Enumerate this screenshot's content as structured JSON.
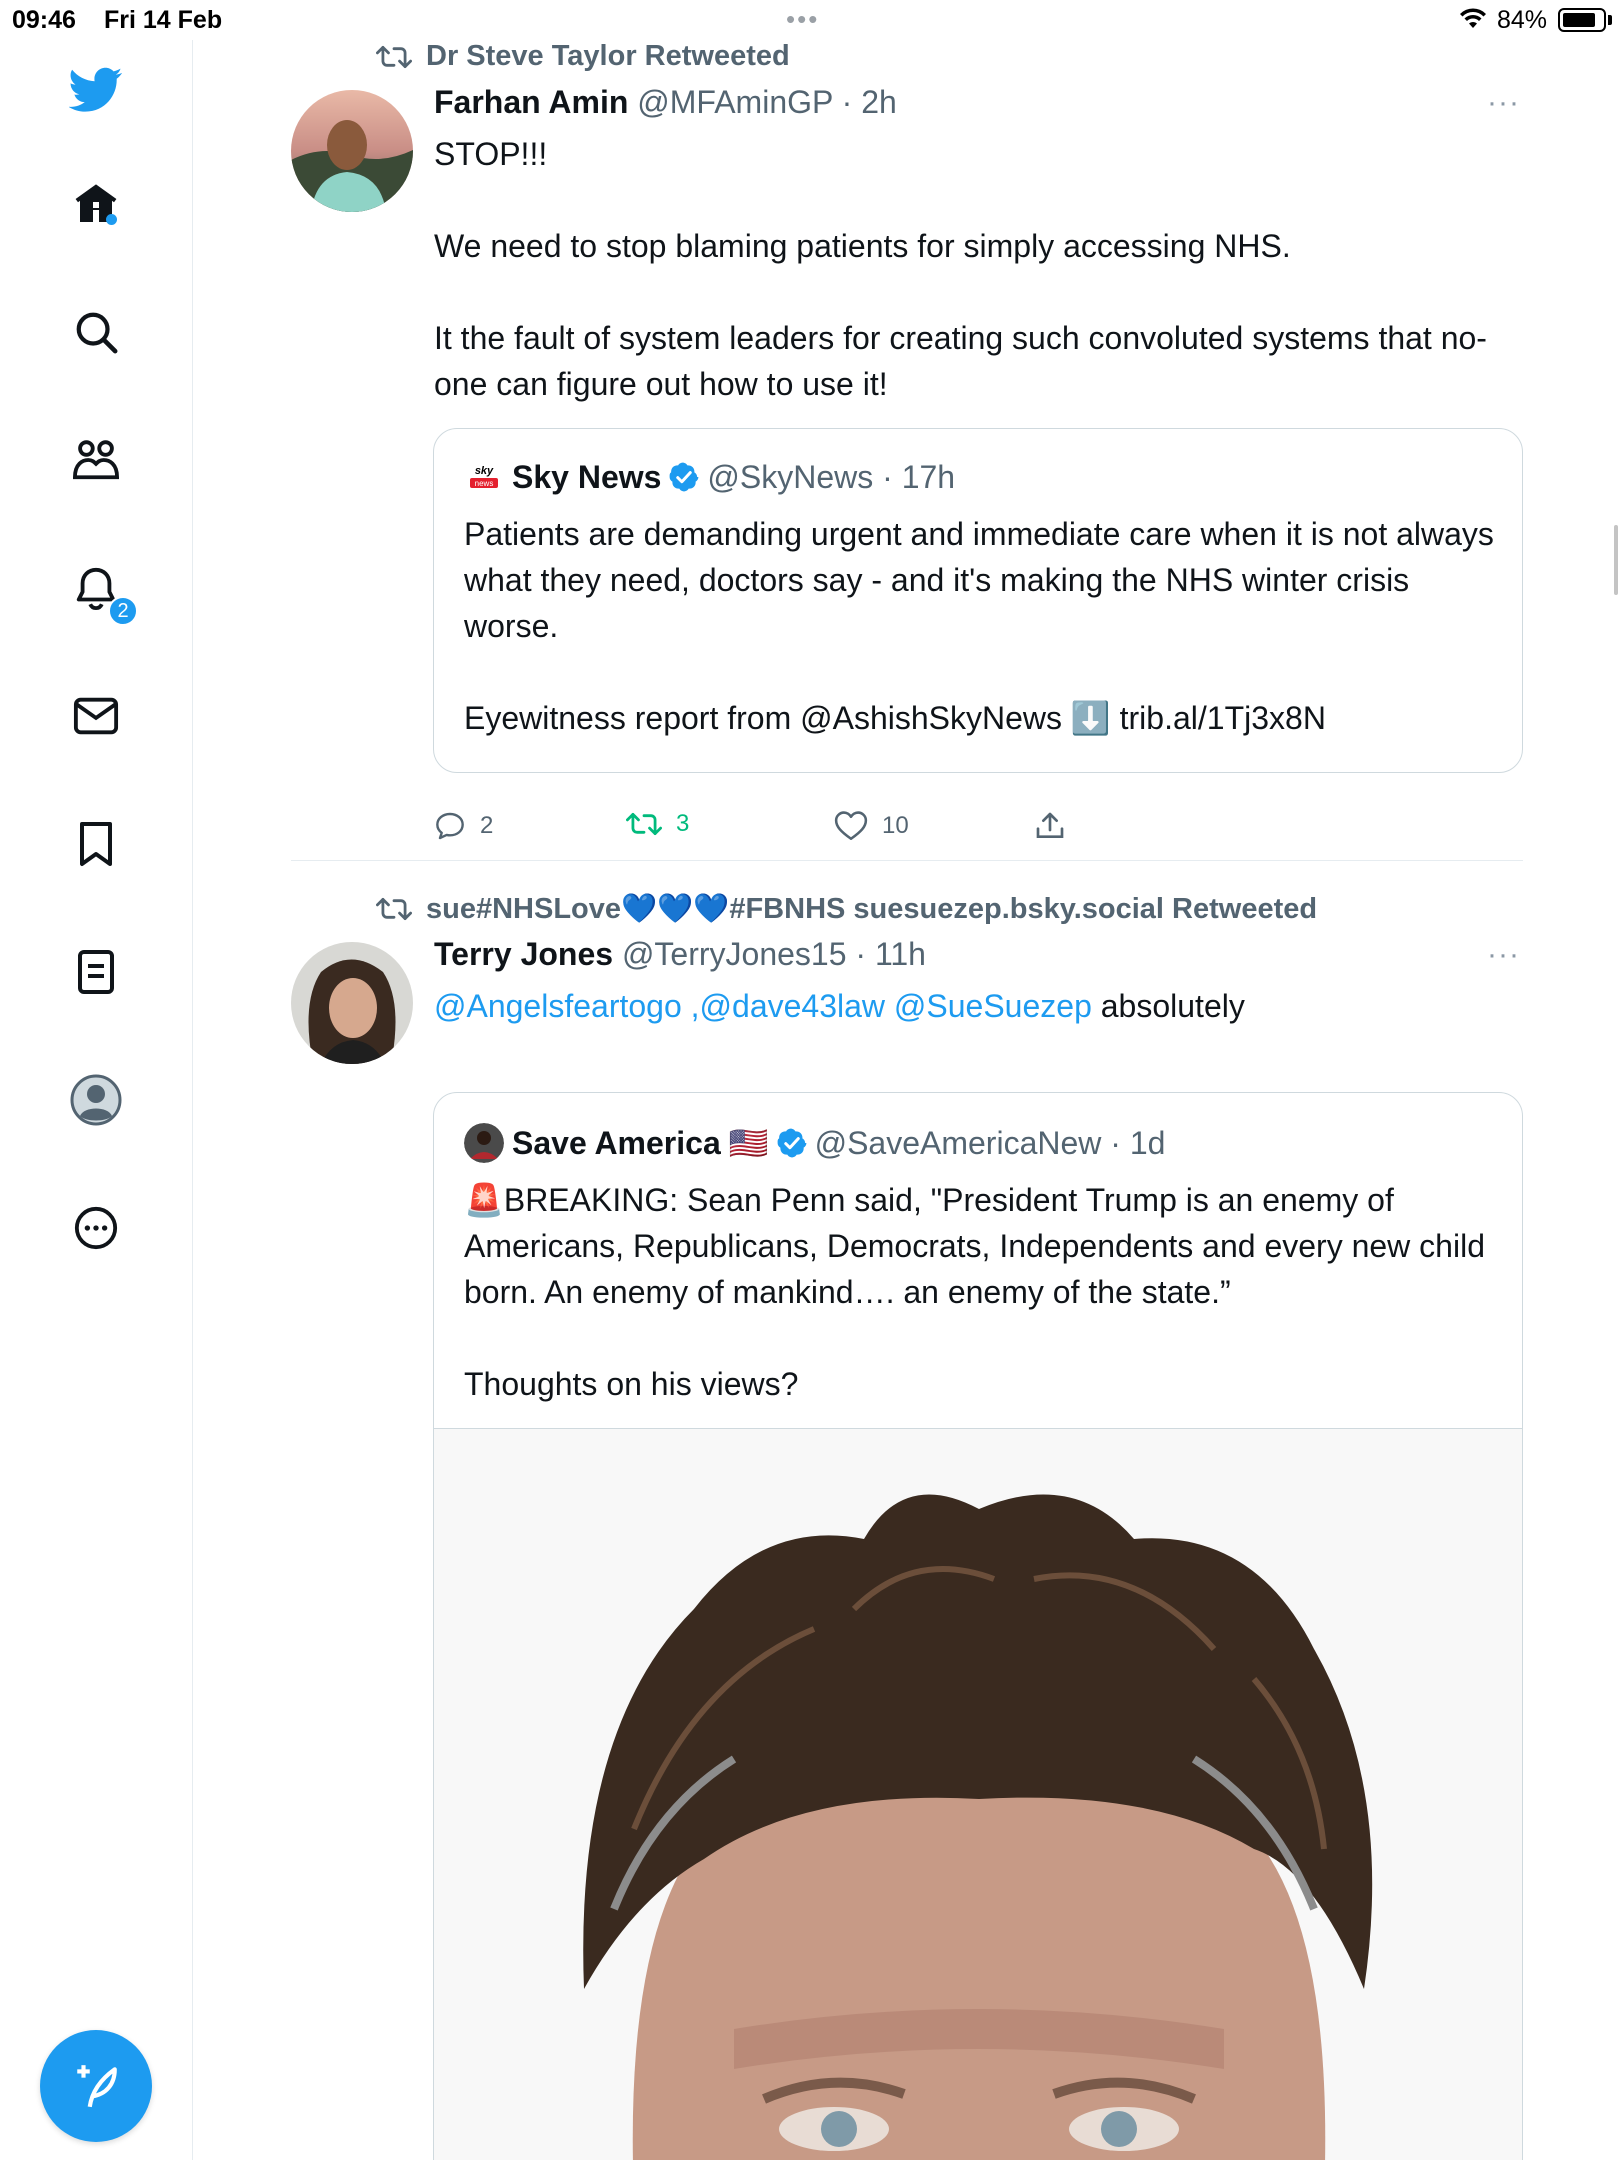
{
  "status_bar": {
    "time": "09:46",
    "date": "Fri 14 Feb",
    "dots": "•••",
    "battery": "84%",
    "battery_level": 0.84
  },
  "sidebar": {
    "items": [
      {
        "name": "twitter-logo"
      },
      {
        "name": "home"
      },
      {
        "name": "search"
      },
      {
        "name": "communities"
      },
      {
        "name": "notifications",
        "badge": "2"
      },
      {
        "name": "messages"
      },
      {
        "name": "bookmarks"
      },
      {
        "name": "lists"
      },
      {
        "name": "profile"
      },
      {
        "name": "more"
      }
    ],
    "notifications_badge": "2"
  },
  "tweets": [
    {
      "retweeted_by": "Dr Steve Taylor Retweeted",
      "author_name": "Farhan Amin",
      "author_meta": "@MFAminGP · 2h",
      "more": "···",
      "text": "STOP!!!\n\nWe need to stop blaming patients for simply accessing NHS.\n\nIt the fault of system leaders for creating such convoluted systems that no-one can figure out how to use it!",
      "quote": {
        "name": "Sky News",
        "meta": "@SkyNews · 17h",
        "avatar_text": "sky news",
        "text": "Patients are demanding urgent and immediate care when it is not always what they need, doctors say - and it's making the NHS winter crisis worse.\n\nEyewitness report from @AshishSkyNews ⬇️ trib.al/1Tj3x8N"
      },
      "actions": {
        "replies": "2",
        "retweets": "3",
        "likes": "10"
      }
    },
    {
      "retweeted_by": "sue#NHSLove💙💙💙#FBNHS suesuezep.bsky.social Retweeted",
      "author_name": "Terry Jones",
      "author_meta": "@TerryJones15 · 11h",
      "more": "···",
      "text_mentions": "@Angelsfeartogo ,@dave43law @SueSuezep",
      "text_rest": " absolutely",
      "quote": {
        "name": "Save America",
        "flag": "🇺🇸",
        "meta": "@SaveAmericaNew · 1d",
        "text": "🚨BREAKING: Sean Penn said, \"President Trump is an enemy of Americans, Republicans, Democrats, Independents and every new child born. An enemy of mankind…. an enemy of the state.”\n\nThoughts on his views?"
      }
    }
  ],
  "colors": {
    "accent": "#1d9bf0",
    "retweet_green": "#00ba7c",
    "secondary_text": "#536471",
    "border": "#cfd9de"
  }
}
